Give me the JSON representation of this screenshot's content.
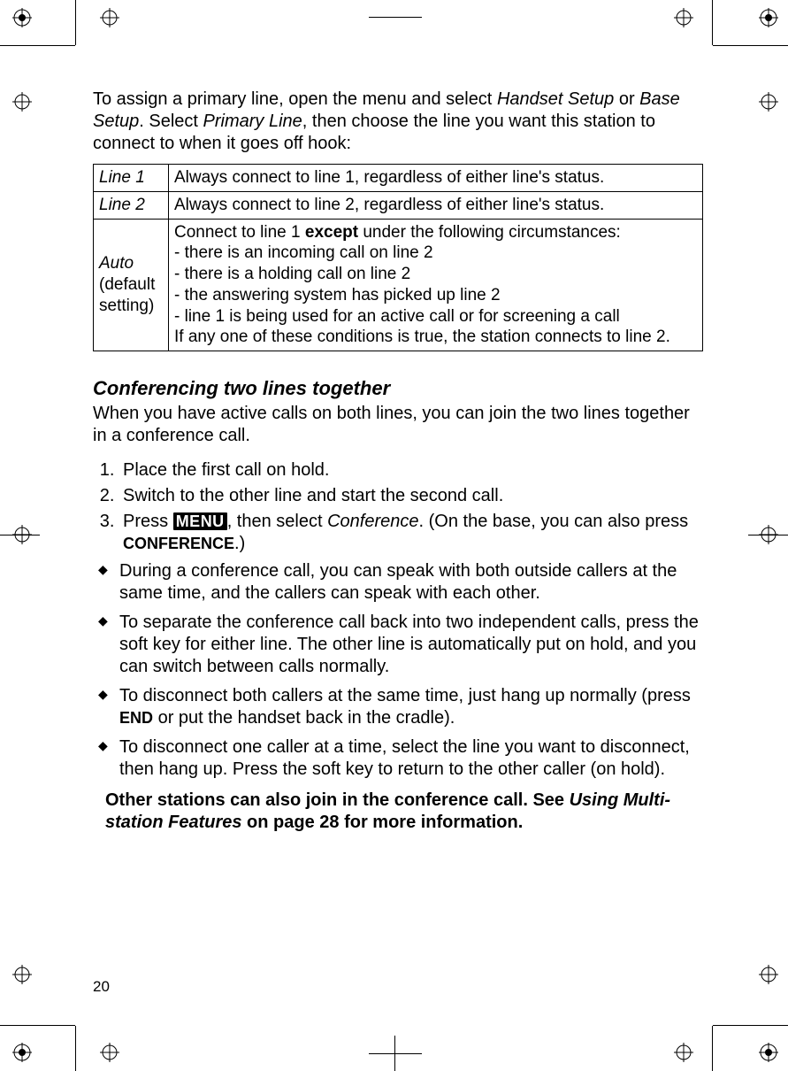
{
  "intro": {
    "p1a": "To assign a primary line, open the menu and select ",
    "i1": "Handset Setup",
    "p1b": " or ",
    "i2": "Base Setup",
    "p1c": ". Select ",
    "i3": "Primary Line",
    "p1d": ", then choose the line you want this station to connect to when it goes off hook:"
  },
  "table": {
    "r1": {
      "opt": "Line 1",
      "desc": "Always connect to line 1, regardless of either line's status."
    },
    "r2": {
      "opt": "Line 2",
      "desc": "Always connect to line 2, regardless of either line's status."
    },
    "r3": {
      "opt_i": "Auto",
      "opt_sub": "(default setting)",
      "d0a": "Connect to line 1 ",
      "d0b": "except",
      "d0c": " under the following circumstances:",
      "d1": "- there is an incoming call on line 2",
      "d2": "- there is a holding call on line 2",
      "d3": "- the answering system has picked up line 2",
      "d4": "- line 1 is being used for an active call or for screening a call",
      "d5": "If any one of these conditions is true, the station connects to line 2."
    }
  },
  "section_title": "Conferencing two lines together",
  "section_intro": "When you have active calls on both lines, you can join the two lines together in a conference call.",
  "steps": {
    "s1": "Place the first call on hold.",
    "s2": "Switch to the other line and start the second call.",
    "s3a": "Press ",
    "s3_menu": "MENU",
    "s3b": ", then select ",
    "s3_i": "Conference",
    "s3c": ". (On the base, you can also press ",
    "s3_key": "CONFERENCE",
    "s3d": ".)"
  },
  "bullets": {
    "b1": "During a conference call, you can speak with both outside callers at the same time, and the callers can speak with each other.",
    "b2": "To separate the conference call back into two independent calls, press the soft key for either line. The other line is automatically put on hold, and you can switch between calls normally.",
    "b3a": "To disconnect both callers at the same time, just hang up normally (press ",
    "b3_key": "END",
    "b3b": " or put the handset back in the cradle).",
    "b4": "To disconnect one caller at a time, select the line you want to disconnect, then hang up. Press the soft key to return to the other caller (on hold)."
  },
  "note": {
    "a": "Other stations can also join in the conference call. See ",
    "i": "Using Multi-station Features",
    "b": " on page 28 for more information."
  },
  "page_number": "20"
}
